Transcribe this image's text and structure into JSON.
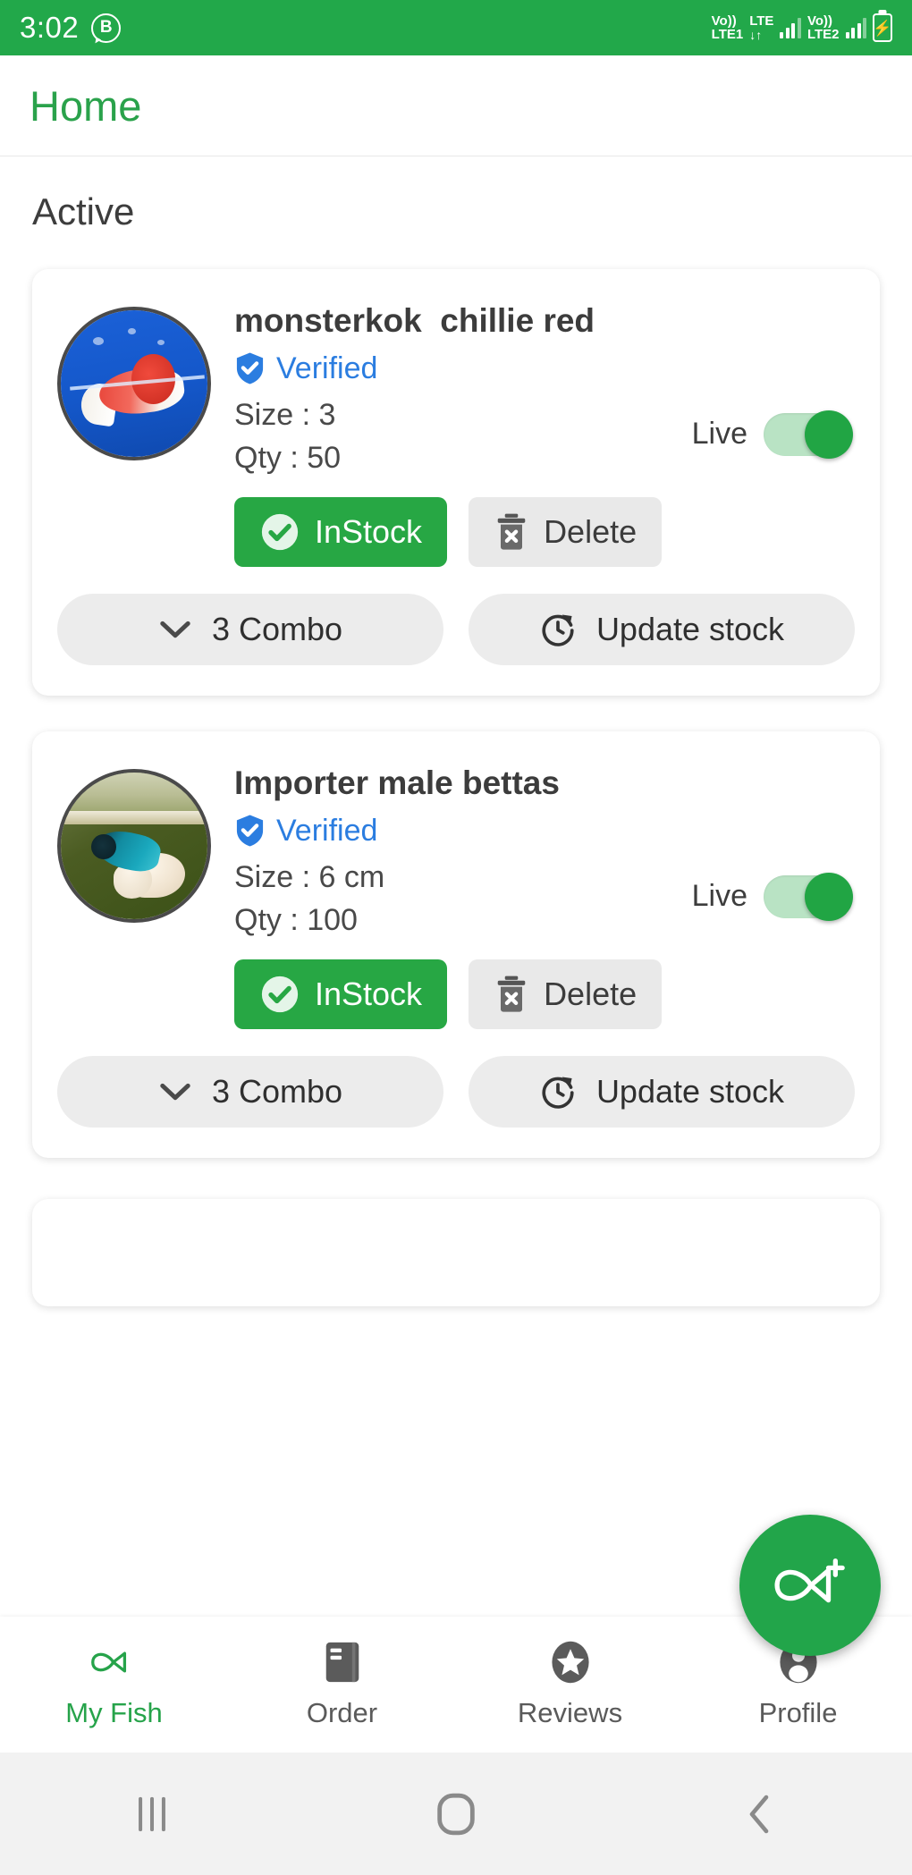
{
  "status_bar": {
    "time": "3:02",
    "business_badge": "B",
    "sim1_volte": "Vo))",
    "sim1_label": "LTE1",
    "lte_label": "LTE",
    "data_arrows": "↓↑",
    "sim2_volte": "Vo))",
    "sim2_label": "LTE2",
    "battery_charging": "⚡",
    "background_color": "#22a84a"
  },
  "app_bar": {
    "title": "Home",
    "title_color": "#2aa24b"
  },
  "section": {
    "title": "Active"
  },
  "cards": [
    {
      "title": "monsterkok  chillie red",
      "verified_label": "Verified",
      "verified_color": "#2b7de0",
      "size": "Size : 3",
      "qty": "Qty : 50",
      "live_label": "Live",
      "live_on": true,
      "instock_label": "InStock",
      "delete_label": "Delete",
      "combo_label": "3 Combo",
      "update_label": "Update stock",
      "thumb_alt": "red and white fish on blue background"
    },
    {
      "title": "Importer male bettas",
      "verified_label": "Verified",
      "verified_color": "#2b7de0",
      "size": "Size : 6 cm",
      "qty": "Qty : 100",
      "live_label": "Live",
      "live_on": true,
      "instock_label": "InStock",
      "delete_label": "Delete",
      "combo_label": "3 Combo",
      "update_label": "Update stock",
      "thumb_alt": "teal betta fish with white fins on green background"
    }
  ],
  "fab": {
    "icon": "fish-plus-icon",
    "color": "#22a54a"
  },
  "bottom_nav": {
    "active_color": "#26a34a",
    "items": [
      {
        "label": "My Fish",
        "icon": "fish-icon",
        "active": true
      },
      {
        "label": "Order",
        "icon": "book-icon",
        "active": false
      },
      {
        "label": "Reviews",
        "icon": "star-circle-icon",
        "active": false
      },
      {
        "label": "Profile",
        "icon": "person-circle-icon",
        "active": false
      }
    ]
  },
  "android_nav": {
    "recents": "recents-icon",
    "home": "home-icon",
    "back": "back-icon"
  }
}
